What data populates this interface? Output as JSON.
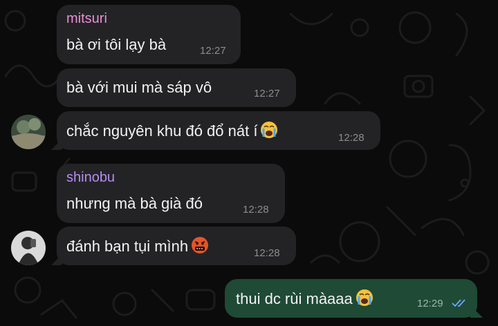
{
  "messages": [
    {
      "sender": "mitsuri",
      "text": "bà ơi tôi lạy bà",
      "time": "12:27"
    },
    {
      "text": "bà với mui mà sáp vô",
      "time": "12:27"
    },
    {
      "text": "chắc nguyên khu đó đổ nát í",
      "emoji": "loudly-crying-face",
      "time": "12:28"
    },
    {
      "sender": "shinobu",
      "text": "nhưng mà bà già đó",
      "time": "12:28"
    },
    {
      "text": "đánh bạn tụi mình",
      "emoji": "face-with-symbols-on-mouth",
      "time": "12:28"
    },
    {
      "text": "thui dc rùi màaaa",
      "emoji": "loudly-crying-face",
      "time": "12:29",
      "status": "read-double-check-icon"
    }
  ],
  "colors": {
    "background": "#0b0b0b",
    "incoming_bubble": "#232325",
    "outgoing_bubble": "#1f4a36",
    "mitsuri_name": "#e98fd6",
    "shinobu_name": "#b68cf4",
    "read_ticks": "#6fa9ff"
  }
}
